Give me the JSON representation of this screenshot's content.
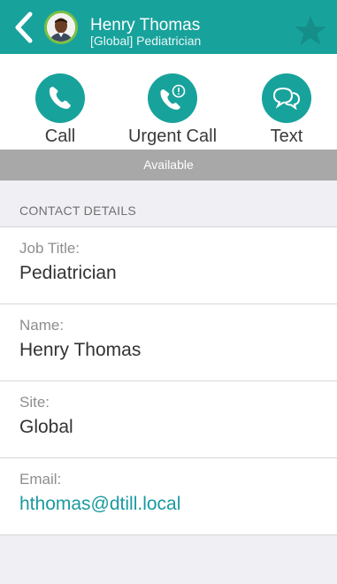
{
  "header": {
    "name": "Henry Thomas",
    "subtitle": "[Global] Pediatrician",
    "back_icon": "chevron-left-icon",
    "favorite_icon": "star-icon",
    "color": "#18a29c"
  },
  "actions": [
    {
      "label": "Call",
      "icon": "phone-icon"
    },
    {
      "label": "Urgent Call",
      "icon": "urgent-phone-icon"
    },
    {
      "label": "Text",
      "icon": "chat-bubble-icon"
    }
  ],
  "status": {
    "text": "Available",
    "color": "#a8a8a8"
  },
  "contact": {
    "section_title": "CONTACT DETAILS",
    "fields": [
      {
        "label": "Job Title:",
        "value": "Pediatrician"
      },
      {
        "label": "Name:",
        "value": "Henry Thomas"
      },
      {
        "label": "Site:",
        "value": "Global"
      },
      {
        "label": "Email:",
        "value": "hthomas@dtill.local"
      }
    ]
  }
}
